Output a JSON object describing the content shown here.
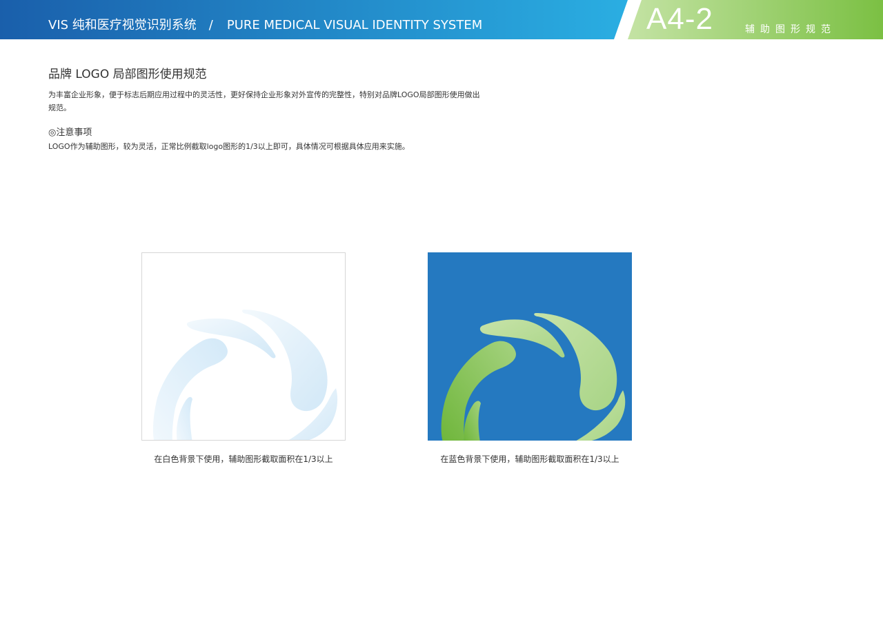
{
  "header": {
    "system_cn": "VIS  纯和医疗视觉识别系统",
    "separator": "/",
    "system_en": "PURE MEDICAL VISUAL IDENTITY SYSTEM",
    "page_code": "A4-2",
    "section": "辅助图形规范"
  },
  "content": {
    "title": "品牌 LOGO 局部图形使用规范",
    "description": "为丰富企业形象，便于标志后期应用过程中的灵活性，更好保持企业形象对外宣传的完整性，特别对品牌LOGO局部图形使用做出规范。",
    "notice_title": "◎注意事项",
    "notice_text": "LOGO作为辅助图形，较为灵活，正常比例截取logo图形的1/3以上即可，具体情况可根据具体应用来实施。"
  },
  "examples": [
    {
      "caption": "在白色背景下使用，辅助图形截取面积在1/3以上"
    },
    {
      "caption": "在蓝色背景下使用，辅助图形截取面积在1/3以上"
    }
  ],
  "colors": {
    "header_blue_start": "#1a5fab",
    "header_blue_end": "#2aaee2",
    "header_green_start": "#c4e3a4",
    "header_green_end": "#7bc043",
    "panel_blue": "#2579c0",
    "leaf_light_blue": "#cfe6f6",
    "leaf_green": "#82c24b"
  }
}
